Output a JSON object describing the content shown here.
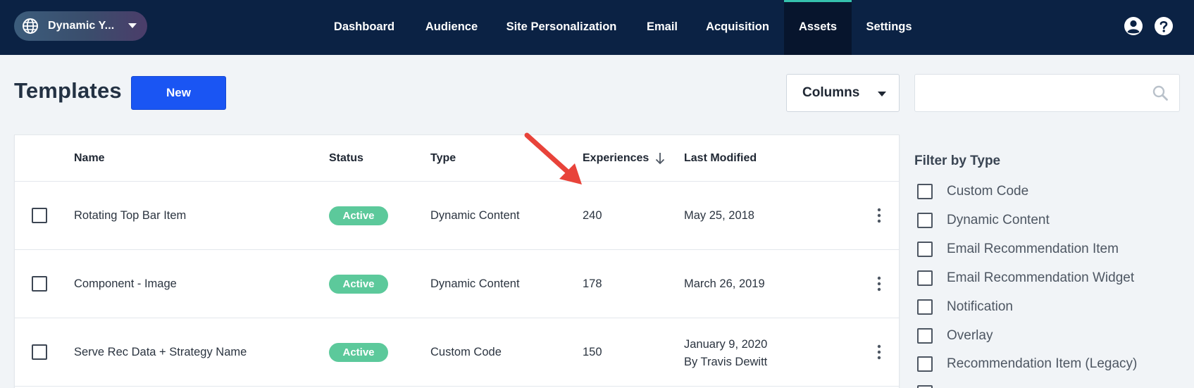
{
  "nav": {
    "site_name": "Dynamic Y...",
    "tabs": [
      {
        "label": "Dashboard",
        "active": false
      },
      {
        "label": "Audience",
        "active": false
      },
      {
        "label": "Site Personalization",
        "active": false
      },
      {
        "label": "Email",
        "active": false
      },
      {
        "label": "Acquisition",
        "active": false
      },
      {
        "label": "Assets",
        "active": true
      },
      {
        "label": "Settings",
        "active": false
      }
    ],
    "icons": [
      "user-icon",
      "help-icon"
    ]
  },
  "page": {
    "title": "Templates",
    "new_label": "New",
    "columns_label": "Columns",
    "search": {
      "value": "",
      "placeholder": ""
    }
  },
  "table": {
    "headers": {
      "name": "Name",
      "status": "Status",
      "type": "Type",
      "experiences": "Experiences",
      "last_modified": "Last Modified"
    },
    "sort": {
      "column": "experiences",
      "direction": "descending"
    },
    "rows": [
      {
        "name": "Rotating Top Bar Item",
        "status": "Active",
        "type": "Dynamic Content",
        "experiences": "240",
        "modified": "May 25, 2018",
        "modified_by": ""
      },
      {
        "name": "Component - Image",
        "status": "Active",
        "type": "Dynamic Content",
        "experiences": "178",
        "modified": "March 26, 2019",
        "modified_by": ""
      },
      {
        "name": "Serve Rec Data + Strategy Name",
        "status": "Active",
        "type": "Custom Code",
        "experiences": "150",
        "modified": "January 9, 2020",
        "modified_by": "By Travis Dewitt"
      }
    ]
  },
  "filter": {
    "title": "Filter by Type",
    "items": [
      "Custom Code",
      "Dynamic Content",
      "Email Recommendation Item",
      "Email Recommendation Widget",
      "Notification",
      "Overlay",
      "Recommendation Item (Legacy)"
    ]
  },
  "colors": {
    "nav_bg": "#0b2244",
    "active_tab_bg": "#07152d",
    "active_tab_accent": "#35c1ad",
    "primary_button": "#1a55f3",
    "status_active": "#5cc99b",
    "annotation_arrow": "#e8433a",
    "page_bg": "#f1f4f7"
  }
}
